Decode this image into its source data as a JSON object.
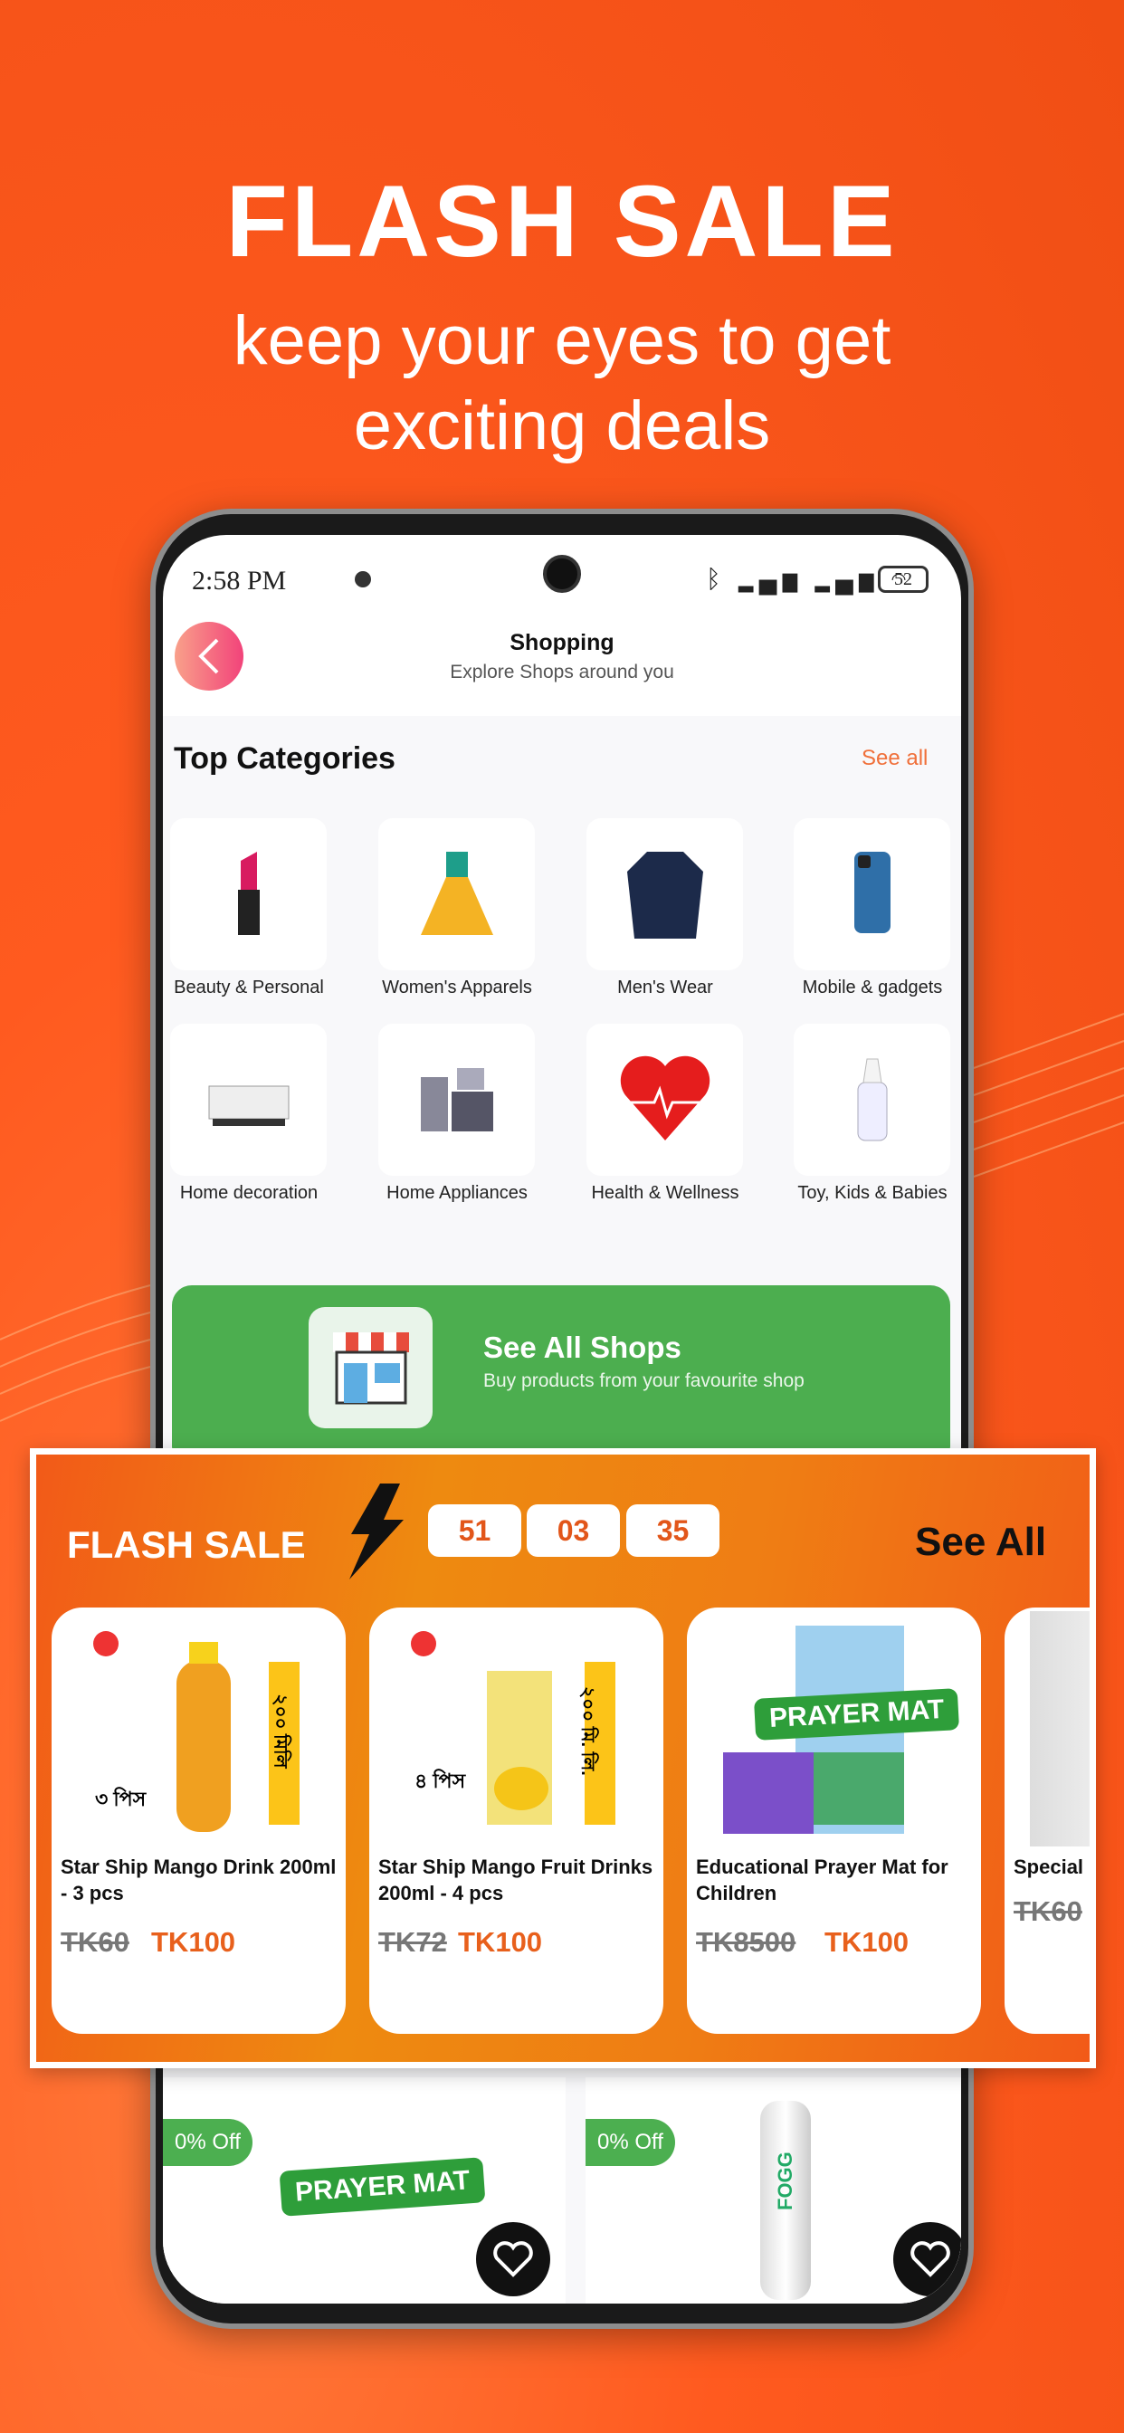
{
  "hero": {
    "title": "FLASH SALE",
    "subtitle_line1": "keep your eyes to get",
    "subtitle_line2": "exciting deals"
  },
  "status_bar": {
    "time": "2:58 PM",
    "battery": "52"
  },
  "header": {
    "title": "Shopping",
    "subtitle": "Explore Shops around you"
  },
  "categories": {
    "title": "Top Categories",
    "see_all": "See all",
    "items": [
      {
        "label": "Beauty & Personal",
        "icon": "lipstick-icon"
      },
      {
        "label": "Women's Apparels",
        "icon": "dress-icon"
      },
      {
        "label": "Men's Wear",
        "icon": "shirt-icon"
      },
      {
        "label": "Mobile & gadgets",
        "icon": "phone-icon"
      },
      {
        "label": "Home decoration",
        "icon": "sofa-icon"
      },
      {
        "label": "Home Appliances",
        "icon": "appliances-icon"
      },
      {
        "label": "Health & Wellness",
        "icon": "heart-pulse-icon"
      },
      {
        "label": "Toy, Kids & Babies",
        "icon": "baby-bottle-icon"
      }
    ]
  },
  "shops_banner": {
    "title": "See All Shops",
    "subtitle": "Buy products from your favourite shop"
  },
  "flash_sale": {
    "title": "FLASH SALE",
    "timer": [
      "51",
      "03",
      "35"
    ],
    "see_all": "See All",
    "products": [
      {
        "name": "Star Ship Mango Drink 200ml - 3 pcs",
        "old_price": "TK60",
        "price": "TK100",
        "pack_label": "৩ পিস",
        "size_label": "২০০ মিলি"
      },
      {
        "name": "Star Ship Mango Fruit Drinks 200ml - 4 pcs",
        "old_price": "TK72",
        "price": "TK100",
        "pack_label": "৪ পিস",
        "size_label": "২০০ মি. লি."
      },
      {
        "name": "Educational Prayer Mat for Children",
        "old_price": "TK8500",
        "price": "TK100",
        "image_text": "PRAYER MAT"
      },
      {
        "name": "Special",
        "old_price": "TK60"
      }
    ]
  },
  "products_below": [
    {
      "badge": "0% Off",
      "image_text": "PRAYER MAT"
    },
    {
      "badge": "0% Off",
      "image_text": "FOGG"
    }
  ],
  "colors": {
    "background": "#ff5a1f",
    "accent": "#e8601c",
    "green": "#4caf50"
  }
}
